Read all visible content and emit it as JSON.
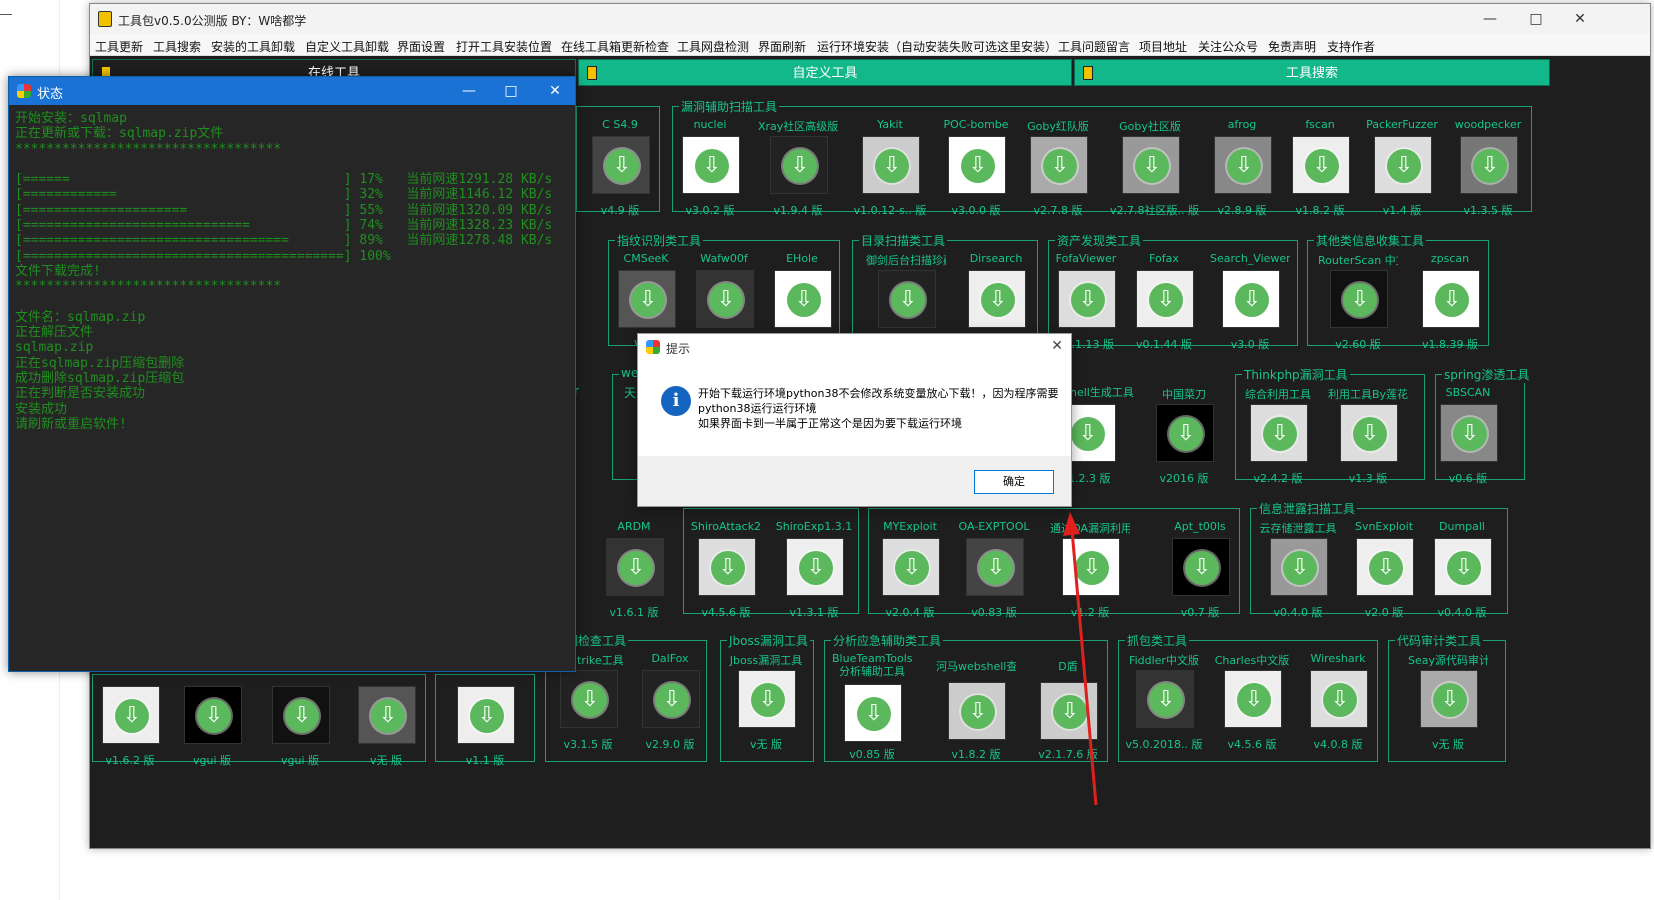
{
  "main_window": {
    "title": "工具包v0.5.0公测版  BY：W啥都学",
    "controls": {
      "minimize": "—",
      "maximize": "□",
      "close": "✕"
    }
  },
  "menu": [
    "工具更新",
    "工具搜索",
    "安装的工具卸载",
    "自定义工具卸载",
    "界面设置",
    "打开工具安装位置",
    "在线工具箱更新检查",
    "工具网盘检测",
    "界面刷新",
    "运行环境安装（自动安装失败可选这里安装）",
    "工具问题留言",
    "项目地址",
    "关注公众号",
    "免责声明",
    "支持作者"
  ],
  "tabs": [
    "在线工具",
    "自定义工具",
    "工具搜索"
  ],
  "groups": [
    {
      "title": "漏洞辅助扫描工具"
    },
    {
      "title": "指纹识别类工具"
    },
    {
      "title": "目录扫描类工具"
    },
    {
      "title": "资产发现类工具"
    },
    {
      "title": "其他类信息收集工具"
    },
    {
      "title": "Thinkphp漏洞工具"
    },
    {
      "title": "spring渗透工具"
    },
    {
      "title": "信息泄露扫描工具"
    },
    {
      "title": "漏洞检查工具"
    },
    {
      "title": "Jboss漏洞工具"
    },
    {
      "title": "分析应急辅助类工具"
    },
    {
      "title": "抓包类工具"
    },
    {
      "title": "代码审计类工具"
    }
  ],
  "partial_labels": {
    "we": "we",
    "tian": "天",
    "r": "r",
    "hell": "hell生成工具",
    "trike": "trike工具",
    "v1": "v1.",
    "shiro_hidden": "Shiro漏洞利用工具",
    "oa_hidden": "OA漏洞利用工具"
  },
  "tools": [
    {
      "name": "C S4.9",
      "version": "v4.9 版"
    },
    {
      "name": "nuclei",
      "version": "v3.0.2 版"
    },
    {
      "name": "Xray社区高级版",
      "version": "v1.9.4 版"
    },
    {
      "name": "Yakit",
      "version": "v1.0.12-s.. 版"
    },
    {
      "name": "POC-bombe",
      "version": "v3.0.0 版"
    },
    {
      "name": "Goby红队版",
      "version": "v2.7.8 版"
    },
    {
      "name": "Goby社区版",
      "version": "v2.7.8社区版.. 版"
    },
    {
      "name": "afrog",
      "version": "v2.8.9 版"
    },
    {
      "name": "fscan",
      "version": "v1.8.2 版"
    },
    {
      "name": "PackerFuzzer",
      "version": "v1.4 版"
    },
    {
      "name": "woodpecker",
      "version": "v1.3.5 版"
    },
    {
      "name": "CMSeeK",
      "version": "v1.1"
    },
    {
      "name": "Wafw00f",
      "version": ""
    },
    {
      "name": "EHole",
      "version": ""
    },
    {
      "name": "御剑后台扫描珍藏",
      "version": ""
    },
    {
      "name": "Dirsearch",
      "version": ""
    },
    {
      "name": "FofaViewer",
      "version": "v1.1.13 版"
    },
    {
      "name": "Fofax",
      "version": "v0.1.44 版"
    },
    {
      "name": "Search_Viewer",
      "version": "v3.0 版"
    },
    {
      "name": "RouterScan 中文",
      "version": "v2.60 版"
    },
    {
      "name": "zpscan",
      "version": "v1.8.39 版"
    },
    {
      "name": "",
      "version": "v1.2.3 版"
    },
    {
      "name": "中国菜刀",
      "version": "v2016 版"
    },
    {
      "name": "综合利用工具",
      "version": "v2.4.2 版"
    },
    {
      "name": "利用工具By莲花",
      "version": "v1.3 版"
    },
    {
      "name": "SBSCAN",
      "version": "v0.6 版"
    },
    {
      "name": "ARDM",
      "version": "v1.6.1 版"
    },
    {
      "name": "ShiroAttack2",
      "version": "v4.5.6 版"
    },
    {
      "name": "ShiroExp1.3.1",
      "version": "v1.3.1 版"
    },
    {
      "name": "MYExploit",
      "version": "v2.0.4 版"
    },
    {
      "name": "OA-EXPTOOL",
      "version": "v0.83 版"
    },
    {
      "name": "通达OA漏洞利用工具",
      "version": "v1.2 版"
    },
    {
      "name": "Apt_t00ls",
      "version": "v0.7 版"
    },
    {
      "name": "云存储泄露工具",
      "version": "v0.4.0 版"
    },
    {
      "name": "SvnExploit",
      "version": "v2.0 版"
    },
    {
      "name": "Dumpall",
      "version": "v0.4.0 版"
    },
    {
      "name": "",
      "version": "v1.6.2 版"
    },
    {
      "name": "",
      "version": "vgui 版"
    },
    {
      "name": "",
      "version": "vgui 版"
    },
    {
      "name": "",
      "version": "v无 版"
    },
    {
      "name": "",
      "version": "v1.1 版"
    },
    {
      "name": "",
      "version": "v3.1.5 版"
    },
    {
      "name": "DalFox",
      "version": "v2.9.0 版"
    },
    {
      "name": "Jboss漏洞工具",
      "version": "v无 版"
    },
    {
      "name": "BlueTeamTools 分析辅助工具",
      "version": "v0.85 版"
    },
    {
      "name": "河马webshell查杀",
      "version": "v1.8.2 版"
    },
    {
      "name": "D盾",
      "version": "v2.1.7.6 版"
    },
    {
      "name": "Fiddler中文版",
      "version": "v5.0.2018.. 版"
    },
    {
      "name": "Charles中文版",
      "version": "v4.5.6 版"
    },
    {
      "name": "Wireshark",
      "version": "v4.0.8 版"
    },
    {
      "name": "Seay源代码审计系统",
      "version": "v无 版"
    }
  ],
  "status_window": {
    "title": "状态",
    "controls": {
      "minimize": "—",
      "maximize": "□",
      "close": "✕"
    },
    "console": "开始安装：sqlmap\n正在更新或下载：sqlmap.zip文件\n**********************************\n\n[======                                   ] 17%   当前网速1291.28 KB/s\n[============                             ] 32%   当前网速1146.12 KB/s\n[=====================                    ] 55%   当前网速1320.09 KB/s\n[=============================            ] 74%   当前网速1328.23 KB/s\n[==================================       ] 89%   当前网速1278.48 KB/s\n[=========================================] 100%\n文件下载完成!\n**********************************\n\n文件名：sqlmap.zip\n正在解压文件\nsqlmap.zip\n正在sqlmap.zip压缩包删除\n成功删除sqlmap.zip压缩包\n正在判断是否安装成功\n安装成功\n请刷新或重启软件!"
  },
  "dialog": {
    "title": "提示",
    "close": "✕",
    "message": "开始下载运行环境python38不会修改系统变量放心下载！，因为程序需要\npython38运行运行环境\n如果界面卡到一半属于正常这个是因为要下载运行环境",
    "ok_label": "确定",
    "info_glyph": "i"
  },
  "colors": {
    "accent_green": "#12b88a",
    "text_green": "#17c48e",
    "console_green": "#1f8f1f",
    "status_blue": "#1a73d4",
    "arrow_red": "#e0201c",
    "download_green": "#5cb85c"
  }
}
